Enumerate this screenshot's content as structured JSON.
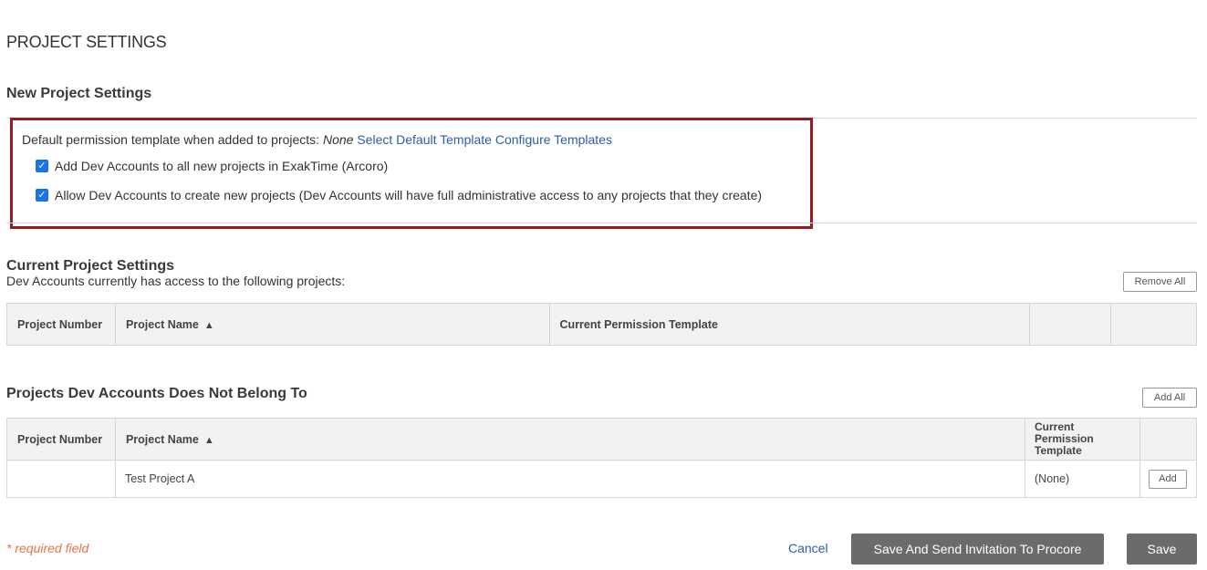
{
  "page": {
    "title": "PROJECT SETTINGS"
  },
  "new_settings": {
    "title": "New Project Settings",
    "permission_label": "Default permission template when added to projects:",
    "permission_value": "None",
    "select_link": "Select Default Template",
    "configure_link": "Configure Templates",
    "checkbox_add_label": "Add Dev Accounts to all new projects in ExakTime (Arcoro)",
    "checkbox_add_checked": true,
    "checkbox_allow_label": "Allow Dev Accounts to create new projects (Dev Accounts will have full administrative access to any projects that they create)",
    "checkbox_allow_checked": true,
    "highlight_color": "#9b1b23"
  },
  "current_settings": {
    "title": "Current Project Settings",
    "access_text": "Dev Accounts currently has access to the following projects:",
    "remove_all_label": "Remove All",
    "columns": [
      "Project Number",
      "Project Name",
      "Current Permission Template"
    ],
    "sort_arrow": "▲",
    "rows": []
  },
  "not_belong": {
    "title": "Projects Dev Accounts Does Not Belong To",
    "add_all_label": "Add All",
    "columns": [
      "Project Number",
      "Project Name",
      "Current Permission Template"
    ],
    "sort_arrow": "▲",
    "rows": [
      {
        "project_number": "",
        "project_name": "Test Project A",
        "template": "(None)",
        "action": "Add"
      }
    ]
  },
  "footer": {
    "required_text": "* required field",
    "cancel_label": "Cancel",
    "save_send_label": "Save And Send Invitation To Procore",
    "save_label": "Save"
  },
  "colors": {
    "link": "#2a5ea8",
    "button_dark": "#6b6b6b",
    "required": "#e8734a",
    "checkbox": "#1a73e8"
  }
}
